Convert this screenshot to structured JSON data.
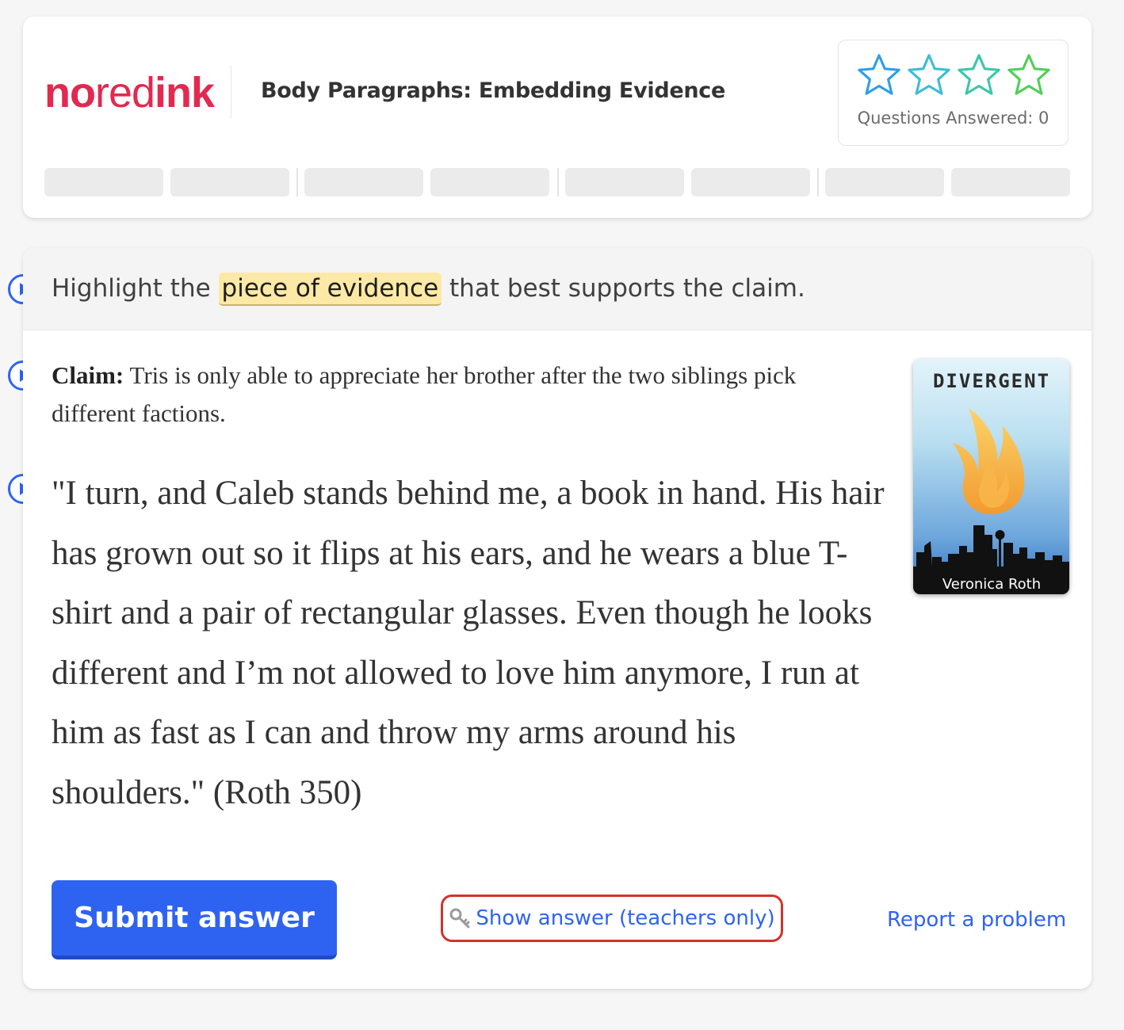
{
  "header": {
    "logo": {
      "part1": "no",
      "part2": "red",
      "part3": "ink"
    },
    "title": "Body Paragraphs: Embedding Evidence",
    "stars": {
      "count": 4,
      "filled": 0,
      "colors": [
        "#2d9ee8",
        "#3cbcd6",
        "#39c7a7",
        "#4fcf57"
      ],
      "label": "Questions Answered: 0"
    },
    "progress_pills": 8,
    "progress_color": "#ebebeb"
  },
  "question": {
    "instructions": {
      "before": "Highlight the",
      "highlight": "piece of evidence",
      "after": "that best supports the claim."
    },
    "claim": {
      "label": "Claim:",
      "text": "Tris is only able to appreciate her brother after the two siblings pick different factions."
    },
    "passage": "\"I turn, and Caleb stands behind me, a book in hand. His hair has grown out so it flips at his ears, and he wears a blue T-shirt and a pair of rectangular glasses. Even though he looks different and I’m not allowed to love him anymore, I run at him as fast as I can and throw my arms around his shoulders.\" (Roth 350)",
    "book": {
      "title": "DIVERGENT",
      "author": "Veronica Roth"
    },
    "actions": {
      "submit": "Submit answer",
      "show_answer": "Show answer (teachers only)",
      "report": "Report a problem"
    }
  },
  "colors": {
    "brand": "#e2294f",
    "primary": "#2e63f2",
    "highlight": "#fde9a6",
    "teacher_outline": "#d0342c"
  },
  "icons": {
    "play": "play-circle-icon",
    "star": "star-outline-icon",
    "key": "key-icon"
  }
}
